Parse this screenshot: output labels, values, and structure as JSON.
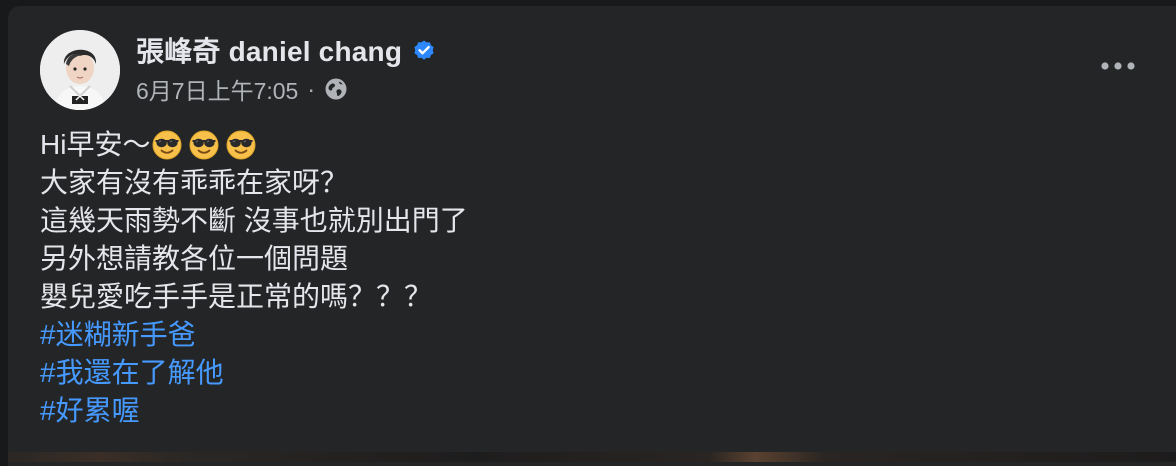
{
  "author": {
    "name": "張峰奇 daniel chang",
    "verified": true,
    "avatar": "profile-photo"
  },
  "meta": {
    "timestamp": "6月7日上午7:05",
    "separator": "·",
    "privacy_icon": "globe-icon"
  },
  "menu": {
    "icon": "more-horizontal-icon"
  },
  "post": {
    "line1": "Hi早安～",
    "emojis": [
      "smiling-face-with-sunglasses",
      "smiling-face-with-sunglasses",
      "smiling-face-with-sunglasses"
    ],
    "lines": [
      "大家有沒有乖乖在家呀？",
      "這幾天雨勢不斷 沒事也就別出門了",
      "另外想請教各位一個問題",
      "嬰兒愛吃手手是正常的嗎？？？"
    ],
    "hashtags": [
      "#迷糊新手爸",
      "#我還在了解他",
      "#好累喔"
    ]
  },
  "colors": {
    "card_background": "#242526",
    "primary_text": "#e4e6eb",
    "secondary_text": "#b0b3b8",
    "hashtag": "#4599ff",
    "verified_badge": "#2d88ff"
  }
}
